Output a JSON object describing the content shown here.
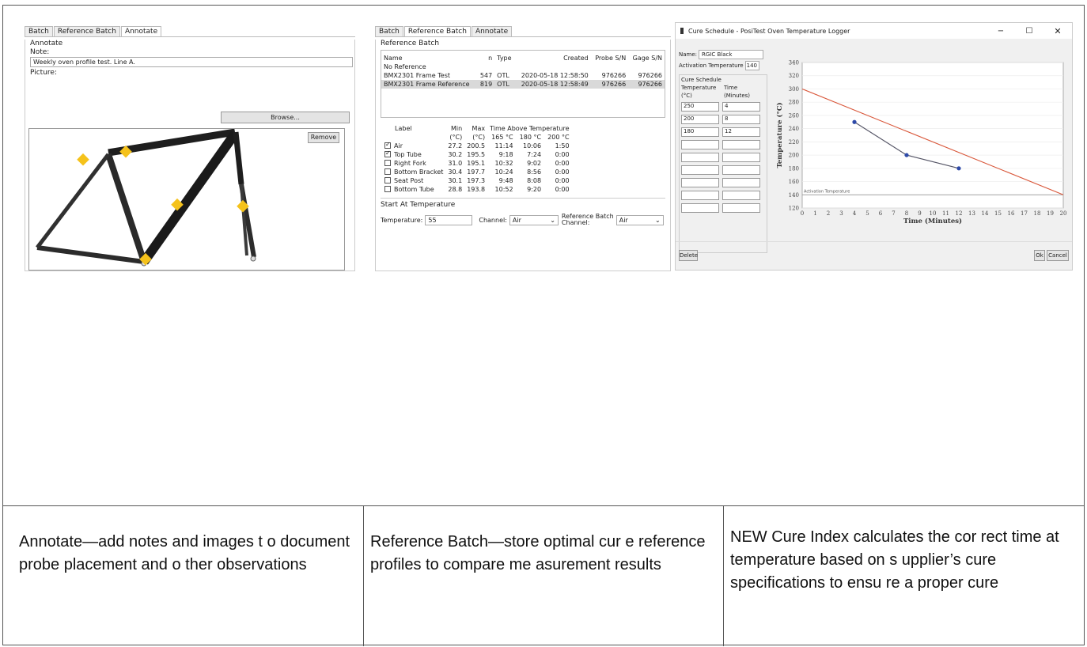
{
  "annotate": {
    "tabs": [
      "Batch",
      "Reference Batch",
      "Annotate"
    ],
    "group": "Annotate",
    "note_label": "Note:",
    "note_value": "Weekly oven profile test. Line A.",
    "picture_label": "Picture:",
    "browse_button": "Browse...",
    "remove_button": "Remove"
  },
  "reference": {
    "tabs": [
      "Batch",
      "Reference Batch",
      "Annotate"
    ],
    "group": "Reference Batch",
    "columns": [
      "Name",
      "n",
      "Type",
      "Created",
      "Probe S/N",
      "Gage S/N"
    ],
    "rows": [
      [
        "No Reference",
        "",
        "",
        "",
        "",
        ""
      ],
      [
        "BMX2301 Frame Test",
        "547",
        "OTL",
        "2020-05-18 12:58:50",
        "976266",
        "976266"
      ],
      [
        "BMX2301 Frame Reference",
        "819",
        "OTL",
        "2020-05-18 12:58:49",
        "976266",
        "976266"
      ]
    ],
    "stats_header": {
      "label": "Label",
      "min": "Min",
      "max": "Max",
      "time_above": "Time Above Temperature",
      "min_unit": "(°C)",
      "max_unit": "(°C)",
      "t1": "165 °C",
      "t2": "180 °C",
      "t3": "200 °C"
    },
    "stats_rows": [
      {
        "checked": true,
        "label": "Air",
        "min": "27.2",
        "max": "200.5",
        "a": "11:14",
        "b": "10:06",
        "c": "1:50"
      },
      {
        "checked": true,
        "label": "Top Tube",
        "min": "30.2",
        "max": "195.5",
        "a": "9:18",
        "b": "7:24",
        "c": "0:00"
      },
      {
        "checked": false,
        "label": "Right Fork",
        "min": "31.0",
        "max": "195.1",
        "a": "10:32",
        "b": "9:02",
        "c": "0:00"
      },
      {
        "checked": false,
        "label": "Bottom Bracket",
        "min": "30.4",
        "max": "197.7",
        "a": "10:24",
        "b": "8:56",
        "c": "0:00"
      },
      {
        "checked": false,
        "label": "Seat Post",
        "min": "30.1",
        "max": "197.3",
        "a": "9:48",
        "b": "8:08",
        "c": "0:00"
      },
      {
        "checked": false,
        "label": "Bottom Tube",
        "min": "28.8",
        "max": "193.8",
        "a": "10:52",
        "b": "9:20",
        "c": "0:00"
      }
    ],
    "start_group": "Start At Temperature",
    "temperature_label": "Temperature:",
    "temperature_value": "55",
    "channel_label": "Channel:",
    "channel_value": "Air",
    "ref_channel_label_1": "Reference Batch",
    "ref_channel_label_2": "Channel:",
    "ref_channel_value": "Air"
  },
  "cure": {
    "window_title": "Cure Schedule - PosiTest Oven Temperature Logger",
    "name_label": "Name:",
    "name_value": "RGIC Black",
    "activation_label": "Activation Temperature",
    "activation_value": "140",
    "schedule_group": "Cure Schedule",
    "col_temp": "Temperature",
    "col_temp_unit": "(°C)",
    "col_time": "Time",
    "col_time_unit": "(Minutes)",
    "schedule_rows": [
      {
        "temp": "250",
        "time": "4"
      },
      {
        "temp": "200",
        "time": "8"
      },
      {
        "temp": "180",
        "time": "12"
      },
      {
        "temp": "",
        "time": ""
      },
      {
        "temp": "",
        "time": ""
      },
      {
        "temp": "",
        "time": ""
      },
      {
        "temp": "",
        "time": ""
      },
      {
        "temp": "",
        "time": ""
      },
      {
        "temp": "",
        "time": ""
      }
    ],
    "delete_button": "Delete",
    "ok_button": "Ok",
    "cancel_button": "Cancel",
    "activation_line_label": "Activation Temperature"
  },
  "chart_data": {
    "type": "line",
    "xlabel": "Time (Minutes)",
    "ylabel": "Temperature (°C)",
    "xlim": [
      0,
      20
    ],
    "ylim": [
      120,
      340
    ],
    "x_ticks": [
      0,
      1,
      2,
      3,
      4,
      5,
      6,
      7,
      8,
      9,
      10,
      11,
      12,
      13,
      14,
      15,
      16,
      17,
      18,
      19,
      20
    ],
    "y_ticks": [
      120,
      140,
      160,
      180,
      200,
      220,
      240,
      260,
      280,
      300,
      320,
      340
    ],
    "grid": true,
    "series": [
      {
        "color": "#d9573a",
        "x": [
          0,
          20
        ],
        "y": [
          300,
          140
        ]
      },
      {
        "color": "#555566",
        "x": [
          4,
          8,
          12
        ],
        "y": [
          250,
          200,
          180
        ]
      }
    ],
    "points": [
      {
        "x": 4,
        "y": 250
      },
      {
        "x": 8,
        "y": 200
      },
      {
        "x": 12,
        "y": 180
      }
    ],
    "activation_temperature": 140
  },
  "captions": [
    "Annotate—add notes and images t o document probe placement and o ther observations",
    "Reference Batch—store optimal cur e reference profiles to compare me asurement results",
    "NEW Cure Index calculates the cor rect time at temperature based on s upplier’s cure specifications to ensu re a proper cure"
  ]
}
